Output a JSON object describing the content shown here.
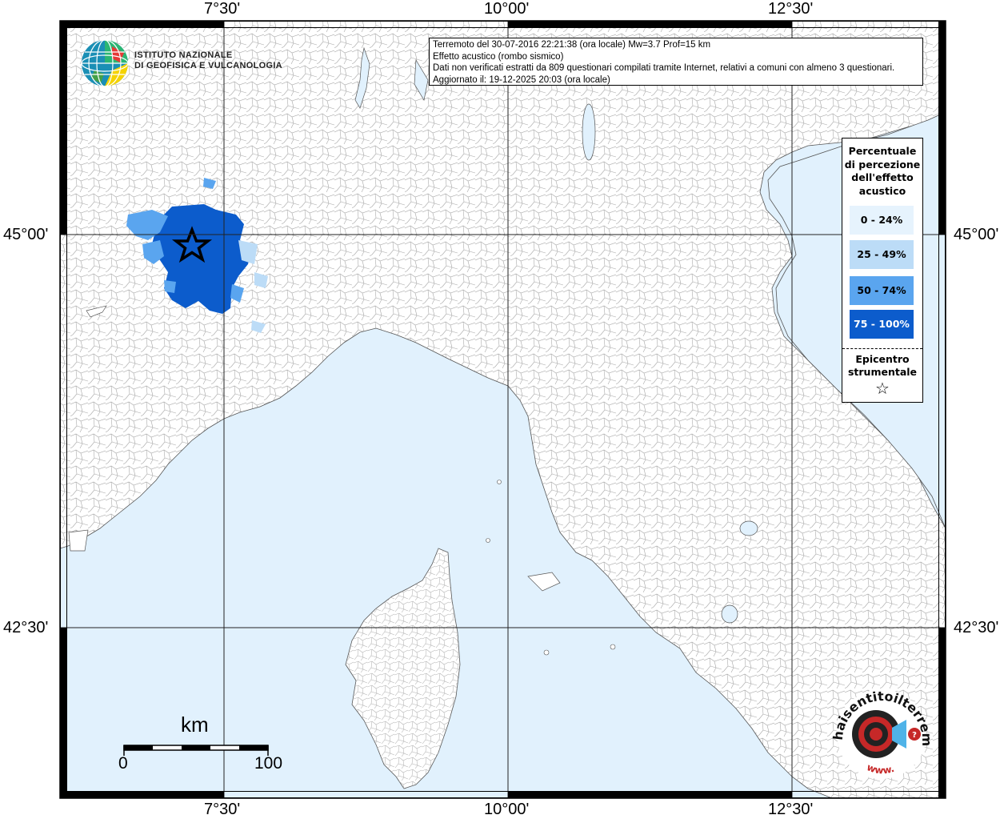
{
  "info": {
    "line1": "Terremoto del 30-07-2016 22:21:38 (ora locale) Mw=3.7 Prof=15 km",
    "line2": "Effetto acustico (rombo sismico)",
    "line3": "Dati non verificati estratti da 809 questionari compilati tramite Internet, relativi a comuni con almeno 3 questionari.",
    "line4": "Aggiornato il: 19-12-2025 20:03 (ora locale)"
  },
  "axes": {
    "x_ticks": [
      "7°30'",
      "10°00'",
      "12°30'"
    ],
    "y_ticks": [
      "45°00'",
      "42°30'"
    ]
  },
  "logo": {
    "line1": "ISTITUTO NAZIONALE",
    "line2": "DI GEOFISICA E VULCANOLOGIA"
  },
  "legend": {
    "title_lines": [
      "Percentuale",
      "di percezione",
      "dell'effetto",
      "acustico"
    ],
    "items": [
      {
        "label": "0 - 24%",
        "color": "#e6f3fd"
      },
      {
        "label": "25 - 49%",
        "color": "#bcdcf7"
      },
      {
        "label": "50 - 74%",
        "color": "#5aa5ef"
      },
      {
        "label": "75 - 100%",
        "color": "#0c5ccc",
        "text_color": "#ffffff"
      }
    ],
    "epicenter_lines": [
      "Epicentro",
      "strumentale"
    ],
    "epicenter_symbol": "☆"
  },
  "scale": {
    "unit": "km",
    "start": "0",
    "end": "100"
  },
  "badge": {
    "arc_top": "haisentitoilterremoto.it",
    "arc_bottom": "www."
  },
  "colors": {
    "sea": "#e1f1fd",
    "land": "#ffffff",
    "borders": "#9a9a9a"
  }
}
